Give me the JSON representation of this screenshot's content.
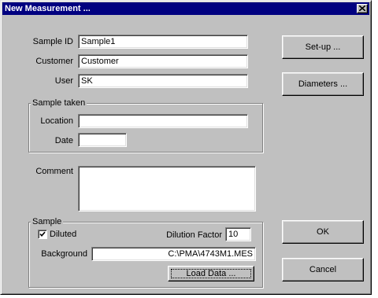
{
  "window": {
    "title": "New Measurement ..."
  },
  "form": {
    "sample_id_label": "Sample ID",
    "sample_id_value": "Sample1",
    "customer_label": "Customer",
    "customer_value": "Customer",
    "user_label": "User",
    "user_value": "SK",
    "comment_label": "Comment",
    "comment_value": ""
  },
  "sample_taken": {
    "group_label": "Sample taken",
    "location_label": "Location",
    "location_value": "",
    "date_label": "Date",
    "date_value": ""
  },
  "sample": {
    "group_label": "Sample",
    "diluted_label": "Diluted",
    "diluted_checked": true,
    "dilution_factor_label": "Dilution Factor",
    "dilution_factor_value": "10",
    "background_label": "Background",
    "background_value": "C:\\PMA\\4743M1.MES",
    "load_data_label": "Load Data ..."
  },
  "buttons": {
    "setup": "Set-up ...",
    "diameters": "Diameters ...",
    "ok": "OK",
    "cancel": "Cancel"
  },
  "icons": {
    "close": "close-icon",
    "check": "checkmark-icon"
  }
}
